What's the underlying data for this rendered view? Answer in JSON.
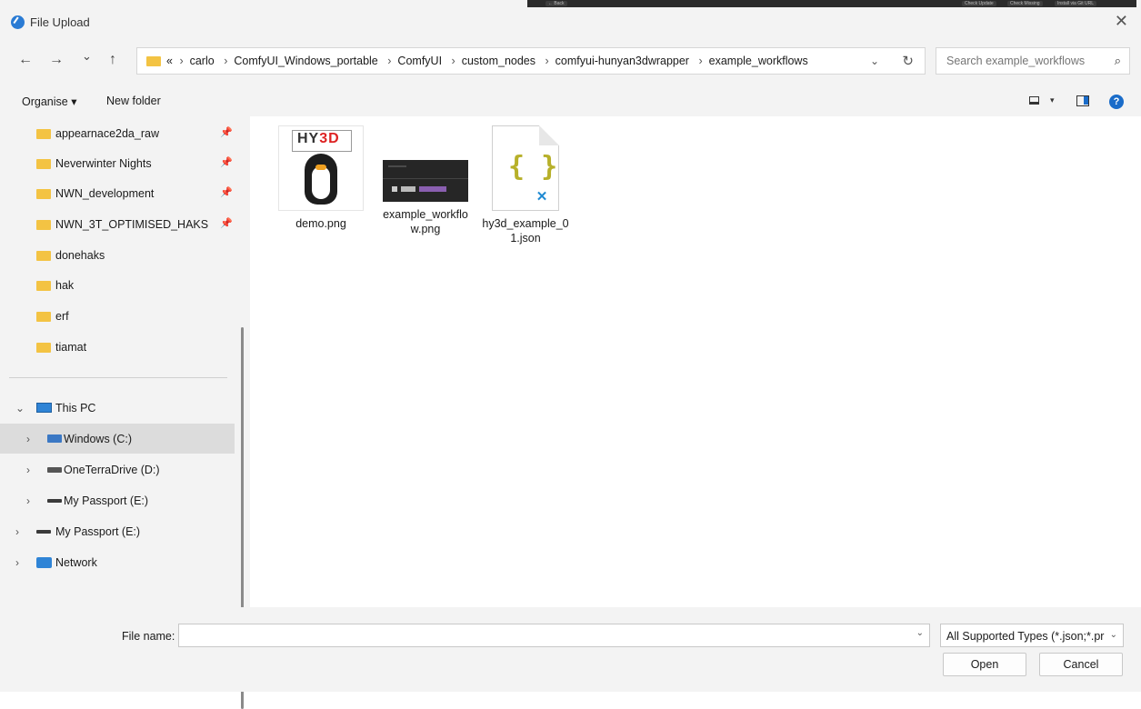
{
  "window": {
    "title": "File Upload",
    "close_glyph": "✕"
  },
  "background_strip": {
    "items": [
      "← Back",
      "Check Update",
      "Check Missing",
      "Install via Git URL"
    ]
  },
  "nav": {
    "back": "←",
    "forward": "→",
    "recent": "⌄",
    "up": "↑",
    "overflow": "«",
    "breadcrumbs": [
      "carlo",
      "ComfyUI_Windows_portable",
      "ComfyUI",
      "custom_nodes",
      "comfyui-hunyan3dwrapper",
      "example_workflows"
    ],
    "separator": "›",
    "dropdown": "⌄",
    "refresh": "↻"
  },
  "search": {
    "placeholder": "Search example_workflows",
    "icon": "search-icon"
  },
  "toolbar": {
    "organise": "Organise ▾",
    "new_folder": "New folder",
    "view_dropdown": "▾",
    "help": "?"
  },
  "sidebar": {
    "quick_access": [
      {
        "label": "appearnace2da_raw",
        "pinned": true
      },
      {
        "label": "Neverwinter Nights",
        "pinned": true
      },
      {
        "label": "NWN_development",
        "pinned": true
      },
      {
        "label": "NWN_3T_OPTIMISED_HAKS",
        "pinned": true
      },
      {
        "label": "donehaks",
        "pinned": false
      },
      {
        "label": "hak",
        "pinned": false
      },
      {
        "label": "erf",
        "pinned": false
      },
      {
        "label": "tiamat",
        "pinned": false
      }
    ],
    "pin_glyph": "📌",
    "this_pc": {
      "label": "This PC",
      "chevron": "⌄"
    },
    "drives": [
      {
        "label": "Windows (C:)",
        "chevron": "›",
        "selected": true
      },
      {
        "label": "OneTerraDrive (D:)",
        "chevron": "›",
        "selected": false
      },
      {
        "label": "My Passport (E:)",
        "chevron": "›",
        "selected": false
      }
    ],
    "root_items": [
      {
        "label": "My Passport (E:)",
        "chevron": "›"
      },
      {
        "label": "Network",
        "chevron": "›"
      }
    ]
  },
  "files": [
    {
      "name": "demo.png",
      "type": "image",
      "thumb_text": "HY3D"
    },
    {
      "name": "example_workflow.png",
      "name_line1": "example_workflo",
      "name_line2": "w.png",
      "type": "image"
    },
    {
      "name": "hy3d_example_01.json",
      "name_line1": "hy3d_example_0",
      "name_line2": "1.json",
      "type": "json",
      "thumb_text": "{ }"
    }
  ],
  "bottom": {
    "file_name_label": "File name:",
    "file_name_value": "",
    "file_type": "All Supported Types (*.json;*.pr",
    "open": "Open",
    "cancel": "Cancel"
  }
}
